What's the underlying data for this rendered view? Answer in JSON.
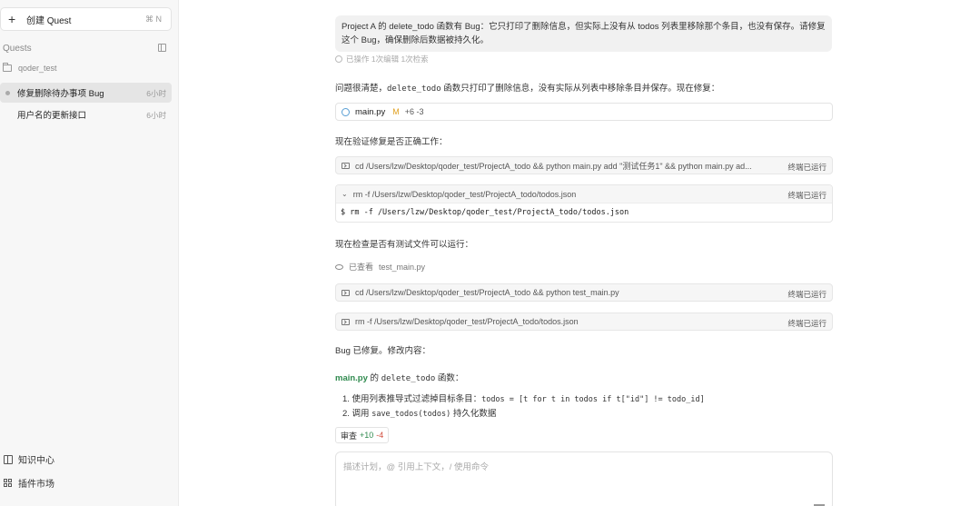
{
  "sidebar": {
    "new_quest": {
      "label": "创建 Quest",
      "shortcut": "⌘ N"
    },
    "quests_header": "Quests",
    "folder": "qoder_test",
    "items": [
      {
        "label": "修复删除待办事项 Bug",
        "time": "6小时",
        "active": true
      },
      {
        "label": "用户名的更新接口",
        "time": "6小时",
        "active": false
      }
    ],
    "footer": [
      {
        "label": "知识中心",
        "icon": "book-icon"
      },
      {
        "label": "插件市场",
        "icon": "grid-icon"
      }
    ]
  },
  "chat": {
    "user_message": "Project A 的 delete_todo 函数有 Bug：它只打印了删除信息，但实际上没有从 todos 列表里移除那个条目，也没有保存。请修复这个 Bug，确保删除后数据被持久化。",
    "user_meta": "已操作 1次编辑 1次检索",
    "intro_a": "问题很清楚，",
    "intro_code": "delete_todo",
    "intro_b": " 函数只打印了删除信息，没有实际从列表中移除条目并保存。现在修复：",
    "file_edit": {
      "name": "main.py",
      "status": "M",
      "diff": "+6 -3"
    },
    "verify_text": "现在验证修复是否正确工作：",
    "terminals": [
      {
        "cmd": "cd /Users/lzw/Desktop/qoder_test/ProjectA_todo && python main.py add \"测试任务1\" && python main.py ad...",
        "status": "终端已运行"
      },
      {
        "cmd": "rm -f /Users/lzw/Desktop/qoder_test/ProjectA_todo/todos.json",
        "status": "终端已运行",
        "output": "$ rm -f /Users/lzw/Desktop/qoder_test/ProjectA_todo/todos.json"
      },
      {
        "cmd": "cd /Users/lzw/Desktop/qoder_test/ProjectA_todo && python test_main.py",
        "status": "终端已运行"
      },
      {
        "cmd": "rm -f /Users/lzw/Desktop/qoder_test/ProjectA_todo/todos.json",
        "status": "终端已运行"
      }
    ],
    "check_text": "现在检查是否有测试文件可以运行：",
    "viewed": {
      "label": "已查看",
      "file": "test_main.py"
    },
    "fixed_text": "Bug 已修复。修改内容：",
    "summary_file": "main.py",
    "summary_mid": " 的 ",
    "summary_fn": "delete_todo",
    "summary_end": " 函数：",
    "list": [
      {
        "prefix": "1. 使用列表推导式过滤掉目标条目：",
        "code": "todos = [t for t in todos if t[\"id\"] != todo_id]",
        "suffix": ""
      },
      {
        "prefix": "2. 调用 ",
        "code": "save_todos(todos)",
        "suffix": " 持久化数据"
      }
    ],
    "changes": {
      "label": "审查",
      "add": "+10",
      "del": "-4"
    },
    "input_placeholder": "描述计划，@ 引用上下文，/ 使用命令"
  }
}
